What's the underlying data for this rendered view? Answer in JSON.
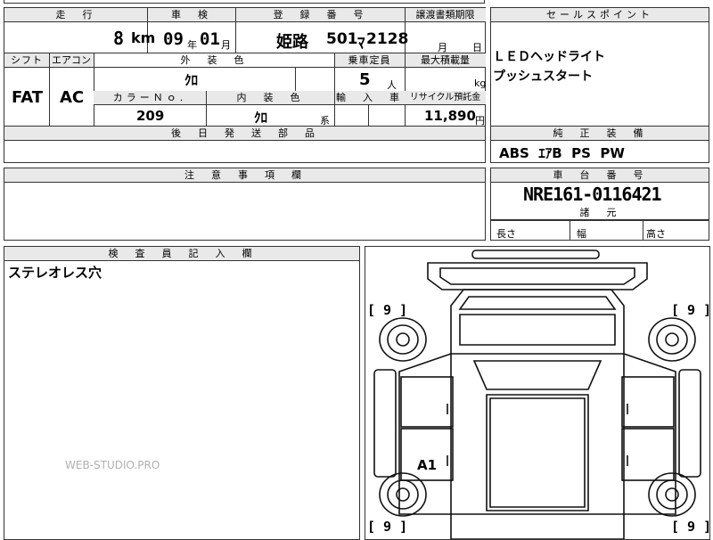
{
  "mileage": {
    "header": "走　行",
    "value": "8",
    "unit": "km"
  },
  "shaken": {
    "header": "車　検",
    "year": "09",
    "year_unit": "年",
    "month": "01",
    "month_unit": "月"
  },
  "registration": {
    "header": "登　録　番　号",
    "region": "姫路",
    "class": "501",
    "kana": "ﾏ",
    "number": "2128"
  },
  "transfer_date": {
    "header": "譲渡書類期限",
    "month_unit": "月",
    "day_unit": "日"
  },
  "sales_point": {
    "header": "セールスポイント",
    "lines": [
      "ＬＥＤヘッドライト",
      "プッシュスタート"
    ]
  },
  "shift": {
    "header": "シフト",
    "value": "FAT"
  },
  "aircon": {
    "header": "エアコン",
    "value": "AC"
  },
  "exterior_color": {
    "header": "外　装　色",
    "value": "ｸﾛ"
  },
  "capacity": {
    "header": "乗車定員",
    "value": "5",
    "unit": "人"
  },
  "max_load": {
    "header": "最大積載量",
    "unit": "kg"
  },
  "color_no": {
    "header": "カラーＮｏ.",
    "value": "209"
  },
  "interior_color": {
    "header": "内　装　色",
    "value": "ｸﾛ",
    "suffix": "系"
  },
  "import": {
    "header": "輸　入　車"
  },
  "recycle": {
    "header": "リサイクル預託金",
    "value": "11,890",
    "unit": "円"
  },
  "parts_later": {
    "header": "後　日　発　送　部　品"
  },
  "standard_equipment": {
    "header": "純　正　装　備",
    "value": "ABS  ｴｱB  PS  PW"
  },
  "notes": {
    "header": "注　意　事　項　欄"
  },
  "chassis": {
    "header": "車　台　番　号",
    "value": "NRE161-0116421"
  },
  "dimensions": {
    "header": "諸　元",
    "length": "長さ",
    "width": "幅",
    "height": "高さ"
  },
  "inspector": {
    "header": "検　査　員　記　入　欄",
    "note": "ステレオレス穴"
  },
  "diagram": {
    "tire_marks": [
      "[ 9 ]",
      "[ 9 ]",
      "[ 9 ]",
      "[ 9 ]"
    ],
    "damage_marks": [
      "A1"
    ]
  },
  "watermark": "WEB-STUDIO.PRO"
}
